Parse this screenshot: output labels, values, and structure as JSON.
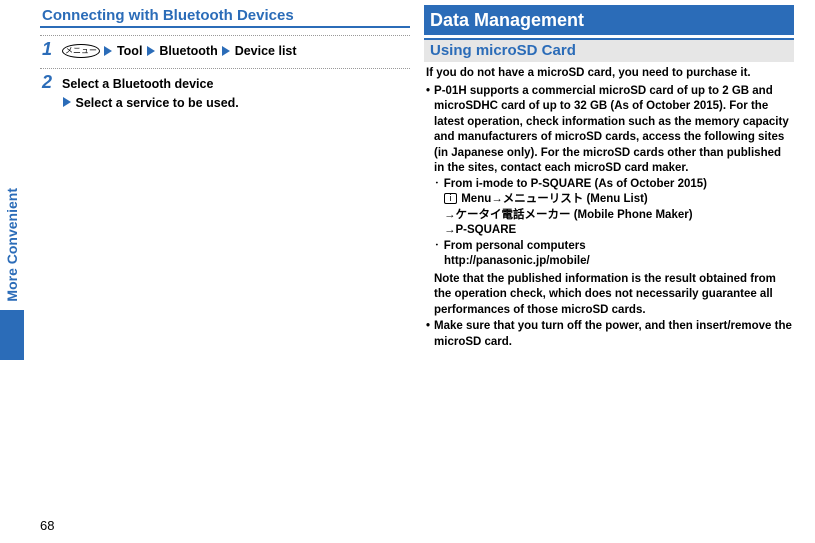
{
  "sideTab": "More Convenient",
  "pageNumber": "68",
  "left": {
    "heading": "Connecting with Bluetooth Devices",
    "step1_num": "1",
    "step1_menu": "メニュー",
    "step1_tool": "Tool",
    "step1_bt": "Bluetooth",
    "step1_devlist": "Device list",
    "step2_num": "2",
    "step2_line1": "Select a Bluetooth device",
    "step2_line2": "Select a service to be used."
  },
  "right": {
    "titleBar": "Data Management",
    "subBar": "Using microSD Card",
    "intro": "If you do not have a microSD card, you need to purchase it.",
    "b1_main": "P-01H supports a commercial microSD card of up to 2 GB and microSDHC card of up to 32 GB (As of October 2015). For the latest operation, check information such as the memory capacity and manufacturers of microSD cards, access the following sites (in Japanese only). For the microSD cards other than published in the sites, contact each microSD card maker.",
    "sb1_title": "From i-mode to P-SQUARE (As of October 2015)",
    "sb1_icon": "ｉ",
    "sb1_l1": "Menu→メニューリスト (Menu List)",
    "sb1_l2": "→ケータイ電話メーカー (Mobile Phone Maker)",
    "sb1_l3": "→P-SQUARE",
    "sb2_title": "From personal computers",
    "sb2_url": "http://panasonic.jp/mobile/",
    "note": "Note that the published information is the result obtained from the operation check, which does not necessarily guarantee all performances of those microSD cards.",
    "b2": "Make sure that you turn off the power, and then insert/remove the microSD card."
  }
}
